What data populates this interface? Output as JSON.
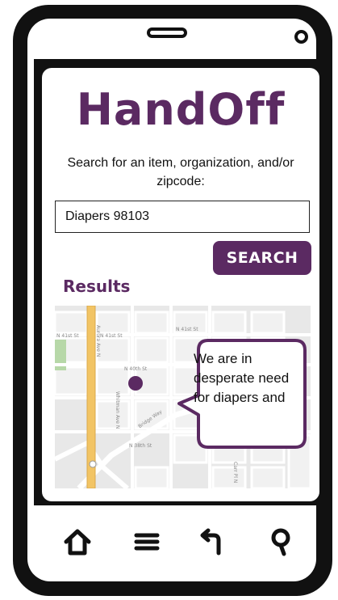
{
  "app": {
    "title": "HandOff"
  },
  "search": {
    "prompt": "Search for an item, organization, and/or zipcode:",
    "value": "Diapers 98103",
    "button_label": "SEARCH"
  },
  "results": {
    "heading": "Results",
    "callout_text": "We are in desperate need for diapers and"
  },
  "map": {
    "street_labels": [
      "N 41st St",
      "N 41st St",
      "N 41st St",
      "N 40th St",
      "Aurora Ave N",
      "Whitman Ave N",
      "Bridge Way",
      "N 38th St",
      "Carr Pl N"
    ]
  },
  "nav": {
    "icons": [
      "home-icon",
      "menu-icon",
      "back-icon",
      "search-icon"
    ]
  },
  "colors": {
    "brand": "#5b2a62",
    "road": "#f2c464",
    "map_bg": "#e9e9e9"
  }
}
